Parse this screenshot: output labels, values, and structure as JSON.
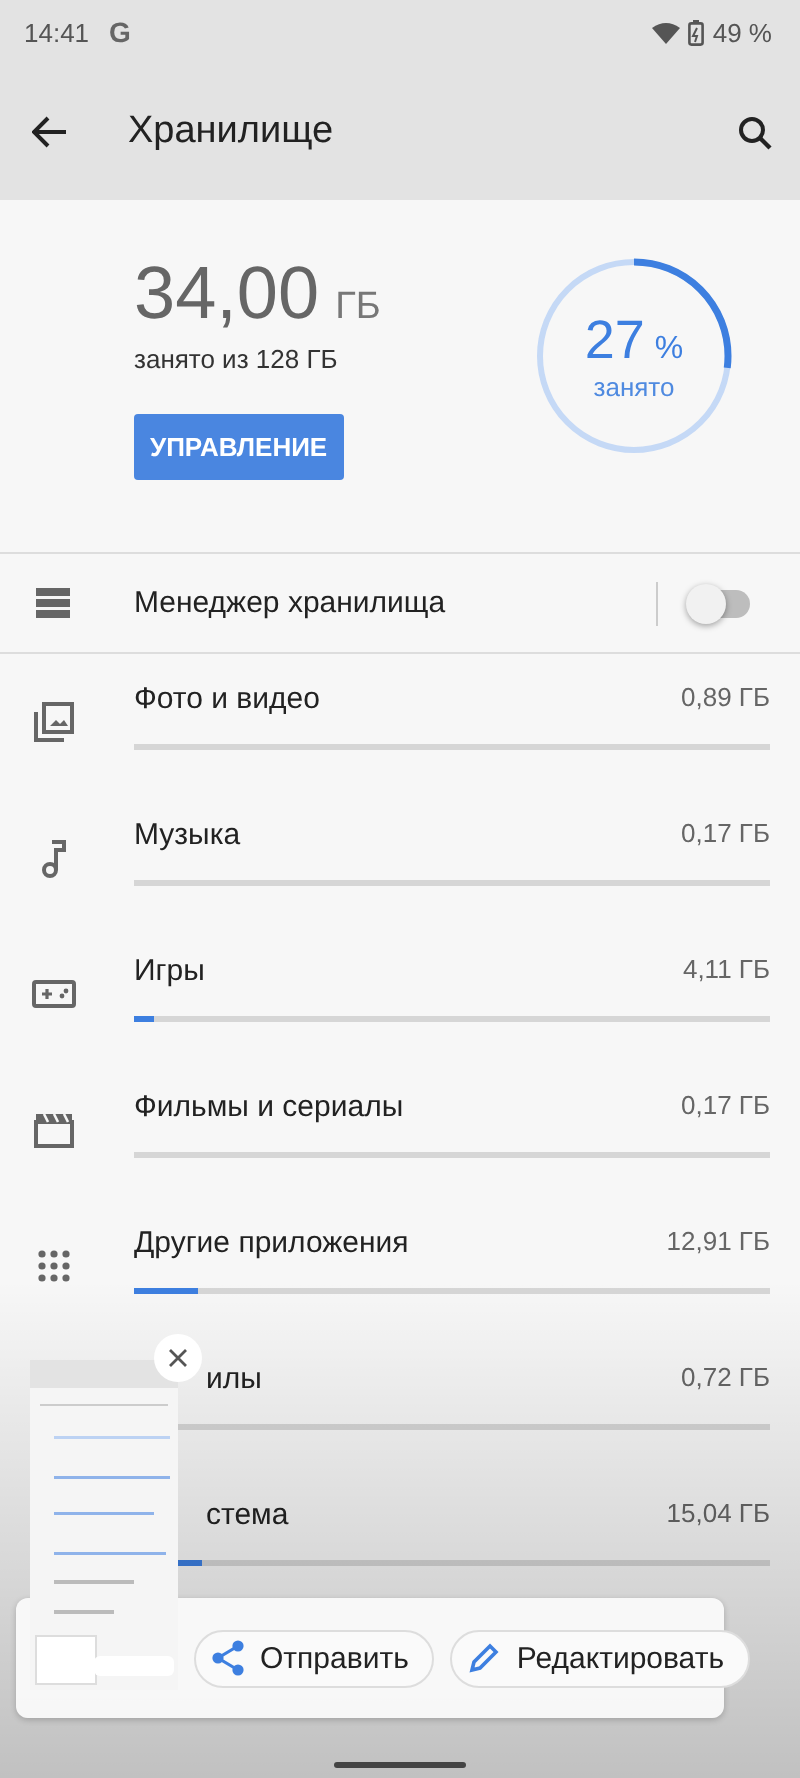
{
  "status_bar": {
    "time": "14:41",
    "g": "G",
    "battery": "49 %"
  },
  "app_bar": {
    "title": "Хранилище"
  },
  "summary": {
    "used": "34,00",
    "unit": "ГБ",
    "caption": "занято из 128 ГБ",
    "button": "УПРАВЛЕНИЕ",
    "percent": "27",
    "percent_sign": "%",
    "percent_caption": "занято"
  },
  "manager": {
    "label": "Менеджер хранилища",
    "on": false
  },
  "categories": [
    {
      "label": "Фото и видео",
      "value": "0,89 ГБ"
    },
    {
      "label": "Музыка",
      "value": "0,17 ГБ"
    },
    {
      "label": "Игры",
      "value": "4,11 ГБ",
      "level": 0.03
    },
    {
      "label": "Фильмы и сериалы",
      "value": "0,17 ГБ"
    },
    {
      "label": "Другие приложения",
      "value": "12,91 ГБ",
      "level": 0.1
    },
    {
      "label": "илы",
      "value": "0,72 ГБ"
    },
    {
      "label": "стема",
      "value": "15,04 ГБ",
      "level": 0.107
    }
  ],
  "screenshot_preview": {
    "kind": "picture",
    "actions": [
      "Отправить",
      "Редактировать"
    ]
  }
}
